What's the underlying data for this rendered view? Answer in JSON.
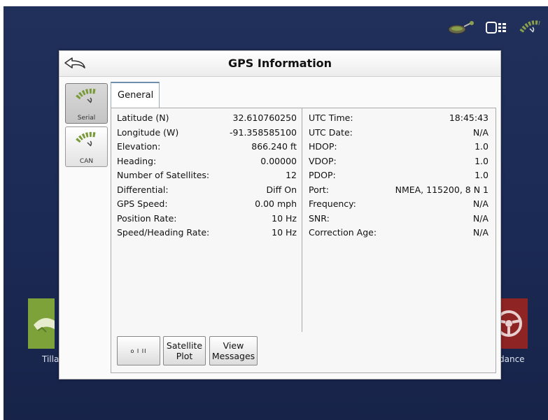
{
  "status_bar": {
    "icons": [
      "gps-antenna-icon",
      "display-module-icon",
      "satellite-signal-icon"
    ]
  },
  "background_tiles": {
    "left_label": "Tilla",
    "right_label": "dance"
  },
  "dialog": {
    "title": "GPS Information",
    "back_icon": "back-arrow-icon"
  },
  "sidebar": {
    "items": [
      {
        "label": "Serial",
        "icon": "satellite-icon",
        "active": true
      },
      {
        "label": "CAN",
        "icon": "satellite-icon",
        "active": false
      }
    ]
  },
  "tabs": [
    {
      "label": "General",
      "active": true
    }
  ],
  "left_fields": [
    {
      "label": "Latitude (N)",
      "value": "32.610760250"
    },
    {
      "label": "Longitude (W)",
      "value": "-91.358585100"
    },
    {
      "label": "Elevation:",
      "value": "866.240 ft"
    },
    {
      "label": "Heading:",
      "value": "0.00000"
    },
    {
      "label": "Number of Satellites:",
      "value": "12"
    },
    {
      "label": "Differential:",
      "value": "Diff On"
    },
    {
      "label": "GPS Speed:",
      "value": "0.00 mph"
    },
    {
      "label": "Position Rate:",
      "value": "10 Hz"
    },
    {
      "label": "Speed/Heading Rate:",
      "value": "10 Hz"
    }
  ],
  "right_fields": [
    {
      "label": "UTC Time:",
      "value": "18:45:43"
    },
    {
      "label": "UTC Date:",
      "value": "N/A"
    },
    {
      "label": "HDOP:",
      "value": "1.0"
    },
    {
      "label": "VDOP:",
      "value": "1.0"
    },
    {
      "label": "PDOP:",
      "value": "1.0"
    },
    {
      "label": "Port:",
      "value": "NMEA, 115200, 8 N 1"
    },
    {
      "label": "Frequency:",
      "value": "N/A"
    },
    {
      "label": "SNR:",
      "value": "N/A"
    },
    {
      "label": "Correction Age:",
      "value": "N/A"
    }
  ],
  "buttons": {
    "first": "o I II",
    "satellite_plot_line1": "Satellite",
    "satellite_plot_line2": "Plot",
    "view_messages_line1": "View",
    "view_messages_line2": "Messages"
  },
  "colors": {
    "screen_bg": "#1b2a55",
    "left_tile": "#7ea23a",
    "right_tile": "#8f2424",
    "tab_accent": "#6f8fb0"
  }
}
